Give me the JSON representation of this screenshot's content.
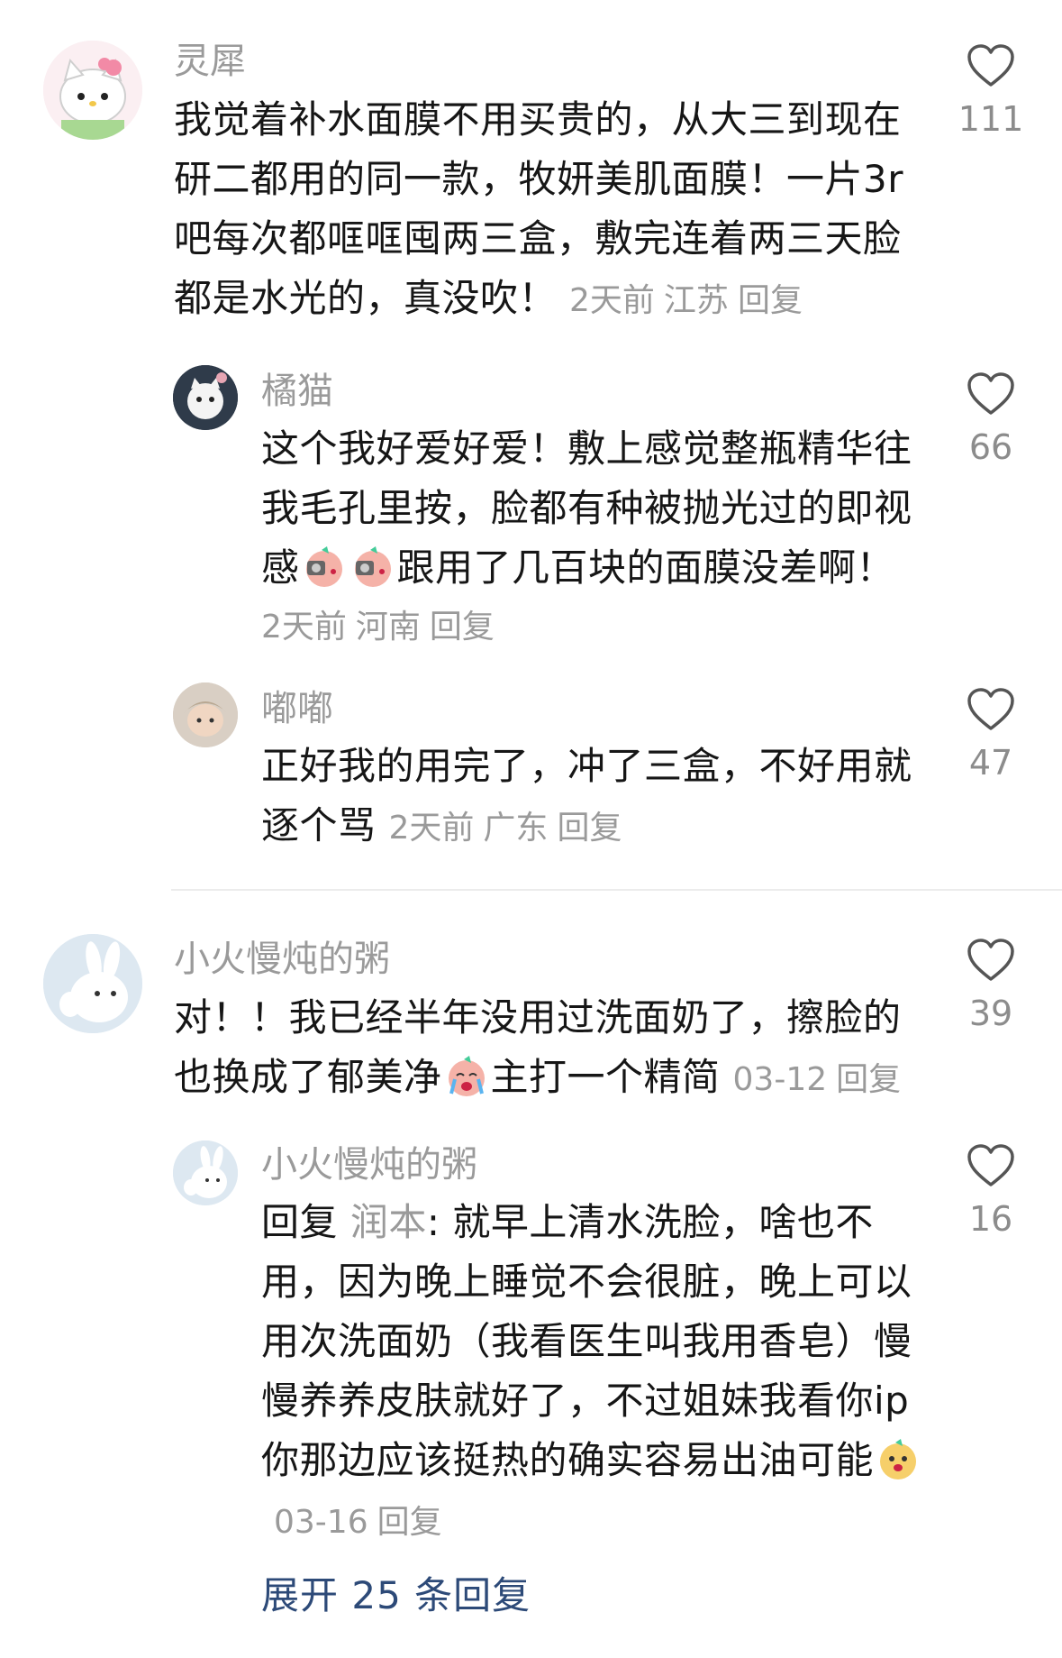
{
  "comments": [
    {
      "username": "灵犀",
      "body": "我觉着补水面膜不用买贵的，从大三到现在研二都用的同一款，牧妍美肌面膜！一片3r吧每次都哐哐囤两三盒，敷完连着两三天脸都是水光的，真没吹！",
      "time": "2天前",
      "location": "江苏",
      "reply_label": "回复",
      "likes": "111",
      "avatar_icon": "hello-kitty-avatar",
      "replies": [
        {
          "username": "橘猫",
          "body_a": "这个我好爱好爱！敷上感觉整瓶精华往我毛孔里按，脸都有种被抛光过的即视感",
          "body_b": "跟用了几百块的面膜没差啊！",
          "time": "2天前",
          "location": "河南",
          "reply_label": "回复",
          "likes": "66",
          "avatar_icon": "cartoon-cat-avatar"
        },
        {
          "username": "嘟嘟",
          "body": "正好我的用完了，冲了三盒，不好用就逐个骂",
          "time": "2天前",
          "location": "广东",
          "reply_label": "回复",
          "likes": "47",
          "avatar_icon": "baby-photo-avatar"
        }
      ]
    },
    {
      "username": "小火慢炖的粥",
      "body_a": "对！！我已经半年没用过洗面奶了，擦脸的也换成了郁美净",
      "body_b": "主打一个精简",
      "time": "03-12",
      "reply_label": "回复",
      "likes": "39",
      "avatar_icon": "white-rabbit-avatar",
      "replies": [
        {
          "username": "小火慢炖的粥",
          "reply_prefix": "回复",
          "reply_to": "润本",
          "body": ": 就早上清水洗脸，啥也不用，因为晚上睡觉不会很脏，晚上可以用次洗面奶（我看医生叫我用香皂）慢慢养养皮肤就好了，不过姐妹我看你ip你那边应该挺热的确实容易出油可能",
          "time": "03-16",
          "reply_label": "回复",
          "likes": "16",
          "avatar_icon": "white-rabbit-avatar"
        }
      ]
    }
  ],
  "expand_label": "展开 25 条回复",
  "colors": {
    "text": "#161616",
    "meta": "#9a9a9a",
    "link": "#2d4a78",
    "divider": "#ececec"
  }
}
